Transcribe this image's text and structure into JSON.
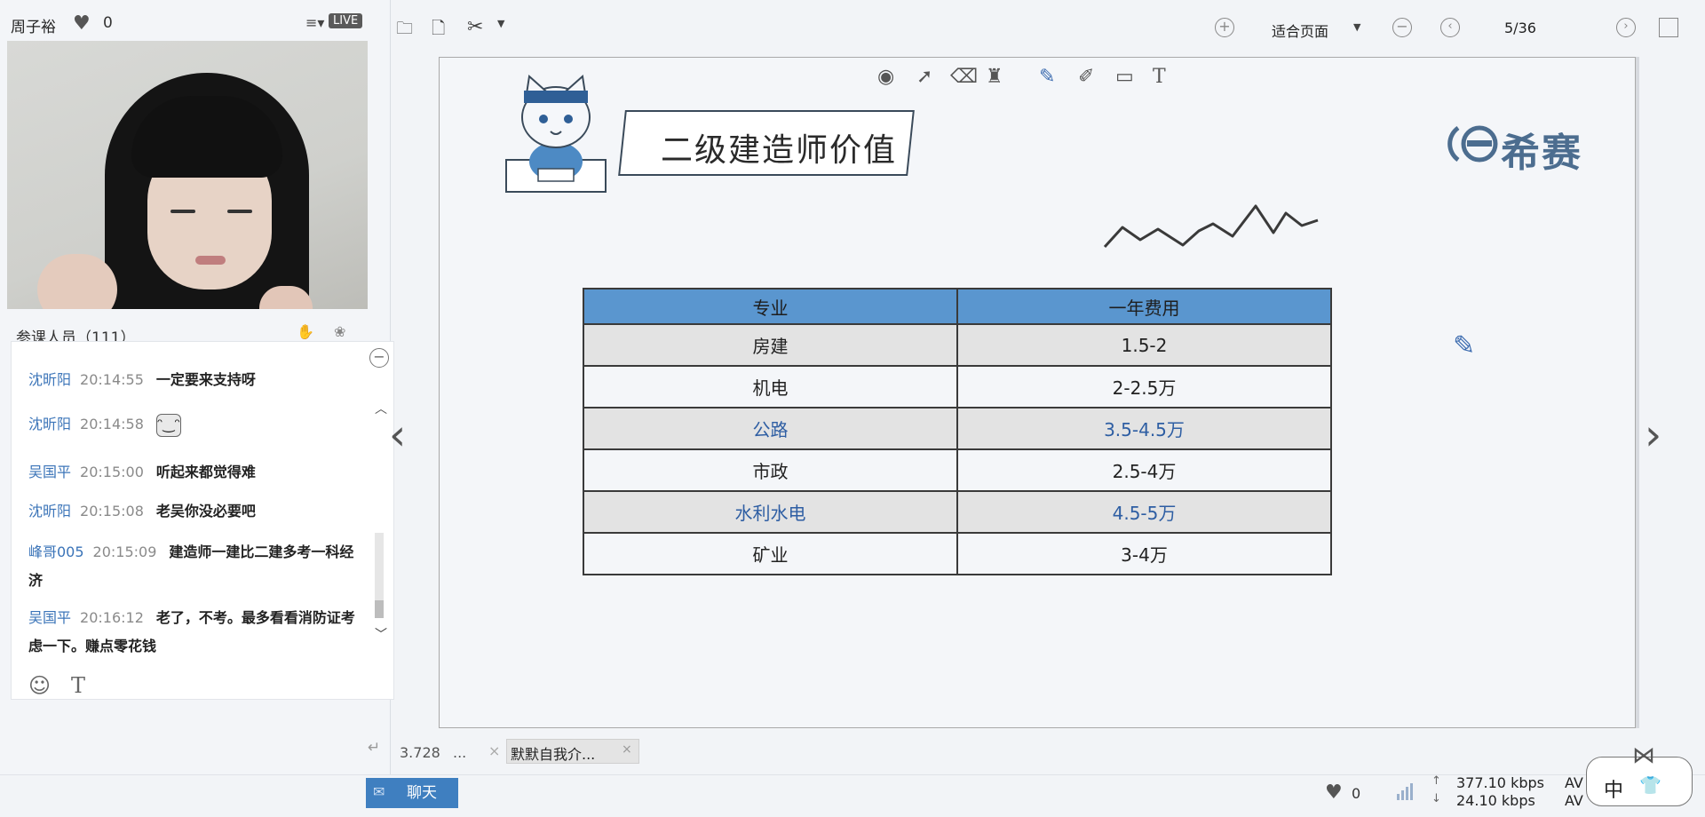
{
  "host": {
    "name": "周子裕",
    "likes": "0",
    "live_badge": "LIVE"
  },
  "attendees_label": "参课人员（111）",
  "chat": {
    "messages": [
      {
        "user": "沈昕阳",
        "time": "20:14:55",
        "text": "一定要来支持呀",
        "emoji": null
      },
      {
        "user": "沈昕阳",
        "time": "20:14:58",
        "text": "",
        "emoji": "grin-emoji"
      },
      {
        "user": "吴国平",
        "time": "20:15:00",
        "text": "听起来都觉得难",
        "emoji": null
      },
      {
        "user": "沈昕阳",
        "time": "20:15:08",
        "text": "老吴你没必要吧",
        "emoji": null
      },
      {
        "user": "峰哥005",
        "time": "20:15:09",
        "text": "建造师一建比二建多考一科经济",
        "emoji": null
      },
      {
        "user": "吴国平",
        "time": "20:16:12",
        "text": "老了，不考。最多看看消防证考虑一下。赚点零花钱",
        "emoji": null
      }
    ],
    "tools": {
      "emoji_icon": "smiley-icon",
      "text_icon": "T"
    }
  },
  "toolbar": {
    "fit_label": "适合页面",
    "page_indicator": "5/36",
    "icons": [
      "folder-icon",
      "file-icon",
      "scissors-icon",
      "zoom-in-icon",
      "zoom-out-icon",
      "prev-page-icon",
      "next-page-icon",
      "fullscreen-icon"
    ]
  },
  "slide": {
    "title": "二级建造师价值",
    "brand": "希赛",
    "table": {
      "headers": [
        "专业",
        "一年费用"
      ],
      "rows": [
        [
          "房建",
          "1.5-2"
        ],
        [
          "机电",
          "2-2.5万"
        ],
        [
          "公路",
          "3.5-4.5万"
        ],
        [
          "市政",
          "2.5-4万"
        ],
        [
          "水利水电",
          "4.5-5万"
        ],
        [
          "矿业",
          "3-4万"
        ]
      ]
    }
  },
  "bottom": {
    "number": "3.728",
    "ellipsis": "...",
    "tab_label": "默默自我介..."
  },
  "status": {
    "chat_tab": "聊天",
    "likes": "0",
    "upload_rate": "377.10 kbps",
    "download_rate": "24.10 kbps",
    "av_label": "AV",
    "ime_lang": "中"
  },
  "colors": {
    "table_header": "#5a96cf",
    "table_shade": "#e3e3e3",
    "chat_user": "#3b74b8",
    "chat_tab": "#3f7fc0",
    "brand": "#4c6d8f"
  }
}
